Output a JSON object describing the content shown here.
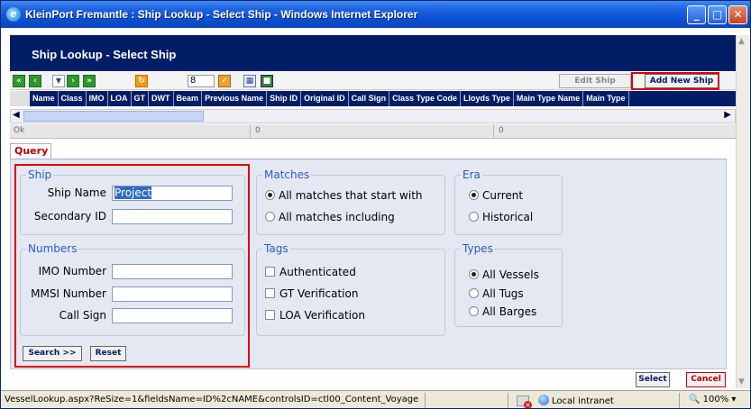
{
  "window": {
    "title": "KleinPort Fremantle : Ship Lookup - Select Ship - Windows Internet Explorer",
    "minimize": "_",
    "maximize": "□",
    "close": "✕"
  },
  "page": {
    "header_title": "Ship Lookup - Select Ship"
  },
  "toolbar": {
    "page_value": "8",
    "edit_ship_label": "Edit Ship",
    "add_new_ship_label": "Add New Ship"
  },
  "grid": {
    "columns": [
      "Name",
      "Class",
      "IMO",
      "LOA",
      "GT",
      "DWT",
      "Beam",
      "Previous Name",
      "Ship ID",
      "Original ID",
      "Call Sign",
      "Class Type Code",
      "Lloyds Type",
      "Main Type Name",
      "Main Type"
    ]
  },
  "status_row": {
    "status": "Ok",
    "count_1": "0",
    "count_2": "0"
  },
  "tabs": {
    "query": "Query"
  },
  "query": {
    "ship": {
      "legend": "Ship",
      "ship_name_label": "Ship Name",
      "ship_name_value": "Project",
      "secondary_id_label": "Secondary ID",
      "secondary_id_value": ""
    },
    "numbers": {
      "legend": "Numbers",
      "imo_label": "IMO Number",
      "mmsi_label": "MMSI Number",
      "call_sign_label": "Call Sign"
    },
    "matches": {
      "legend": "Matches",
      "options": [
        {
          "label": "All matches that start with",
          "selected": true
        },
        {
          "label": "All matches including",
          "selected": false
        }
      ]
    },
    "era": {
      "legend": "Era",
      "options": [
        {
          "label": "Current",
          "selected": true
        },
        {
          "label": "Historical",
          "selected": false
        }
      ]
    },
    "tags": {
      "legend": "Tags",
      "options": [
        {
          "label": "Authenticated",
          "checked": false
        },
        {
          "label": "GT Verification",
          "checked": false
        },
        {
          "label": "LOA Verification",
          "checked": false
        }
      ]
    },
    "types": {
      "legend": "Types",
      "options": [
        {
          "label": "All Vessels",
          "selected": true
        },
        {
          "label": "All Tugs",
          "selected": false
        },
        {
          "label": "All Barges",
          "selected": false
        }
      ]
    },
    "search_label": "Search >>",
    "reset_label": "Reset"
  },
  "footer": {
    "select_label": "Select",
    "cancel_label": "Cancel"
  },
  "ie_status": {
    "url": "VesselLookup.aspx?ReSize=1&fieldsName=ID%2cNAME&controlsID=ctl00_Content_VoyageEditor",
    "zone": "Local intranet",
    "zoom": "100%"
  }
}
